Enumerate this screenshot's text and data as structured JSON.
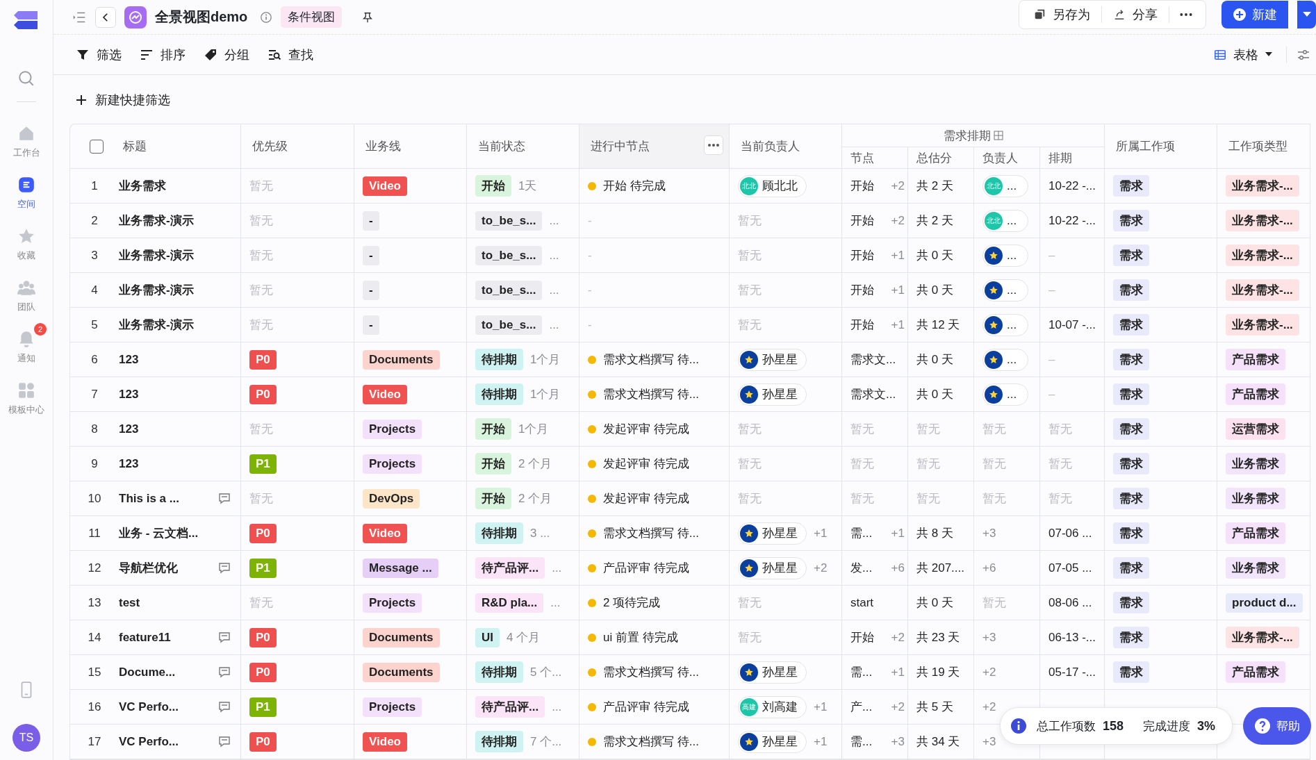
{
  "sidebar": {
    "avatar": "TS",
    "items": [
      {
        "label": "工作台",
        "selected": false
      },
      {
        "label": "空间",
        "selected": true
      },
      {
        "label": "收藏",
        "selected": false
      },
      {
        "label": "团队",
        "selected": false
      },
      {
        "label": "通知",
        "selected": false,
        "badge": "2"
      },
      {
        "label": "模板中心",
        "selected": false
      }
    ]
  },
  "topbar": {
    "title": "全景视图demo",
    "view_tag": "条件视图",
    "actions": [
      "另存为",
      "分享"
    ],
    "new_button": "新建"
  },
  "toolbar": {
    "tools": [
      "筛选",
      "排序",
      "分组",
      "查找"
    ],
    "view_switch": "表格"
  },
  "quick_filter": "新建快捷筛选",
  "table": {
    "select_all_checked": false,
    "columns": [
      {
        "label": "标题",
        "hovered": false
      },
      {
        "label": "优先级",
        "hovered": false
      },
      {
        "label": "业务线",
        "hovered": false
      },
      {
        "label": "当前状态",
        "hovered": false
      },
      {
        "label": "进行中节点",
        "hovered": true
      },
      {
        "label": "当前负责人",
        "hovered": false
      }
    ],
    "group": {
      "label": "需求排期",
      "columns": [
        "节点",
        "总估分",
        "负责人",
        "排期"
      ]
    },
    "columns_after": [
      "所属工作项",
      "工作项类型"
    ],
    "rows": [
      {
        "index": "1",
        "title": "业务需求",
        "comment": false,
        "priority": {
          "text": "暂无",
          "muted": true
        },
        "line": {
          "text": "Video",
          "color": "#f05252",
          "solid": true
        },
        "status": {
          "text": "开始",
          "color": "#d9f4dd",
          "duration": "1天"
        },
        "node": {
          "text": "开始 待完成",
          "dot": true
        },
        "owner": {
          "name": "顾北北",
          "avatar": {
            "kind": "initials",
            "text": "北北"
          }
        },
        "sched_node": {
          "text": "开始",
          "more": "+2"
        },
        "estimate": {
          "text": "共 2 天"
        },
        "sched_owner": {
          "avatar": {
            "kind": "initials",
            "text": "北北"
          },
          "text": "..."
        },
        "schedule": {
          "text": "10-22 -..."
        },
        "work_item": "需求",
        "type": {
          "text": "业务需求-...",
          "color": "#fde3e3"
        }
      },
      {
        "index": "2",
        "title": "业务需求-演示",
        "comment": false,
        "priority": {
          "text": "暂无",
          "muted": true
        },
        "line": {
          "text": "-",
          "color": "#ebebf0",
          "solid": false
        },
        "status": {
          "text": "to_be_s...",
          "color": "#ebebf0",
          "duration": "..."
        },
        "node": {
          "text": "-",
          "dot": false
        },
        "owner": {
          "text": "暂无",
          "muted": true
        },
        "sched_node": {
          "text": "开始",
          "more": "+2"
        },
        "estimate": {
          "text": "共 2 天"
        },
        "sched_owner": {
          "avatar": {
            "kind": "initials",
            "text": "北北"
          },
          "text": "..."
        },
        "schedule": {
          "text": "10-22 -..."
        },
        "work_item": "需求",
        "type": {
          "text": "业务需求-...",
          "color": "#fde3e3"
        }
      },
      {
        "index": "3",
        "title": "业务需求-演示",
        "comment": false,
        "priority": {
          "text": "暂无",
          "muted": true
        },
        "line": {
          "text": "-",
          "color": "#ebebf0",
          "solid": false
        },
        "status": {
          "text": "to_be_s...",
          "color": "#ebebf0",
          "duration": "..."
        },
        "node": {
          "text": "-",
          "dot": false
        },
        "owner": {
          "text": "暂无",
          "muted": true
        },
        "sched_node": {
          "text": "开始",
          "more": "+1"
        },
        "estimate": {
          "text": "共 0 天"
        },
        "sched_owner": {
          "avatar": {
            "kind": "star"
          },
          "text": "..."
        },
        "schedule": {
          "text": "–",
          "muted": true
        },
        "work_item": "需求",
        "type": {
          "text": "业务需求-...",
          "color": "#fde3e3"
        }
      },
      {
        "index": "4",
        "title": "业务需求-演示",
        "comment": false,
        "priority": {
          "text": "暂无",
          "muted": true
        },
        "line": {
          "text": "-",
          "color": "#ebebf0",
          "solid": false
        },
        "status": {
          "text": "to_be_s...",
          "color": "#ebebf0",
          "duration": "..."
        },
        "node": {
          "text": "-",
          "dot": false
        },
        "owner": {
          "text": "暂无",
          "muted": true
        },
        "sched_node": {
          "text": "开始",
          "more": "+1"
        },
        "estimate": {
          "text": "共 0 天"
        },
        "sched_owner": {
          "avatar": {
            "kind": "star"
          },
          "text": "..."
        },
        "schedule": {
          "text": "–",
          "muted": true
        },
        "work_item": "需求",
        "type": {
          "text": "业务需求-...",
          "color": "#fde3e3"
        }
      },
      {
        "index": "5",
        "title": "业务需求-演示",
        "comment": false,
        "priority": {
          "text": "暂无",
          "muted": true
        },
        "line": {
          "text": "-",
          "color": "#ebebf0",
          "solid": false
        },
        "status": {
          "text": "to_be_s...",
          "color": "#ebebf0",
          "duration": "..."
        },
        "node": {
          "text": "-",
          "dot": false
        },
        "owner": {
          "text": "暂无",
          "muted": true
        },
        "sched_node": {
          "text": "开始",
          "more": "+1"
        },
        "estimate": {
          "text": "共 12 天"
        },
        "sched_owner": {
          "avatar": {
            "kind": "star"
          },
          "text": "..."
        },
        "schedule": {
          "text": "10-07 -..."
        },
        "work_item": "需求",
        "type": {
          "text": "业务需求-...",
          "color": "#fde3e3"
        }
      },
      {
        "index": "6",
        "title": "123",
        "comment": false,
        "priority": {
          "text": "P0",
          "color": "#f04f4f"
        },
        "line": {
          "text": "Documents",
          "color": "#fcd3cd",
          "solid": false
        },
        "status": {
          "text": "待排期",
          "color": "#cff3f2",
          "duration": "1个月"
        },
        "node": {
          "text": "需求文档撰写 待...",
          "dot": true
        },
        "owner": {
          "name": "孙星星",
          "avatar": {
            "kind": "star"
          }
        },
        "sched_node": {
          "text": "需求文..."
        },
        "estimate": {
          "text": "共 0 天"
        },
        "sched_owner": {
          "avatar": {
            "kind": "star"
          },
          "text": "..."
        },
        "schedule": {
          "text": "–",
          "muted": true
        },
        "work_item": "需求",
        "type": {
          "text": "产品需求",
          "color": "#f6e1fb"
        }
      },
      {
        "index": "7",
        "title": "123",
        "comment": false,
        "priority": {
          "text": "P0",
          "color": "#f04f4f"
        },
        "line": {
          "text": "Video",
          "color": "#f05252",
          "solid": true
        },
        "status": {
          "text": "待排期",
          "color": "#cff3f2",
          "duration": "1个月"
        },
        "node": {
          "text": "需求文档撰写 待...",
          "dot": true
        },
        "owner": {
          "name": "孙星星",
          "avatar": {
            "kind": "star"
          }
        },
        "sched_node": {
          "text": "需求文..."
        },
        "estimate": {
          "text": "共 0 天"
        },
        "sched_owner": {
          "avatar": {
            "kind": "star"
          },
          "text": "..."
        },
        "schedule": {
          "text": "–",
          "muted": true
        },
        "work_item": "需求",
        "type": {
          "text": "产品需求",
          "color": "#f6e1fb"
        }
      },
      {
        "index": "8",
        "title": "123",
        "comment": false,
        "priority": {
          "text": "暂无",
          "muted": true
        },
        "line": {
          "text": "Projects",
          "color": "#f3e1fb",
          "solid": false
        },
        "status": {
          "text": "开始",
          "color": "#d9f4dd",
          "duration": "1个月"
        },
        "node": {
          "text": "发起评审 待完成",
          "dot": true
        },
        "owner": {
          "text": "暂无",
          "muted": true
        },
        "sched_node": {
          "text": "暂无",
          "muted": true
        },
        "estimate": {
          "text": "暂无",
          "muted": true
        },
        "sched_owner": {
          "text": "暂无",
          "muted": true
        },
        "schedule": {
          "text": "暂无",
          "muted": true
        },
        "work_item": "需求",
        "type": {
          "text": "运营需求",
          "color": "#fde1ee"
        }
      },
      {
        "index": "9",
        "title": "123",
        "comment": false,
        "priority": {
          "text": "P1",
          "color": "#7cb305"
        },
        "line": {
          "text": "Projects",
          "color": "#f3e1fb",
          "solid": false
        },
        "status": {
          "text": "开始",
          "color": "#d9f4dd",
          "duration": "2 个月"
        },
        "node": {
          "text": "发起评审 待完成",
          "dot": true
        },
        "owner": {
          "text": "暂无",
          "muted": true
        },
        "sched_node": {
          "text": "暂无",
          "muted": true
        },
        "estimate": {
          "text": "暂无",
          "muted": true
        },
        "sched_owner": {
          "text": "暂无",
          "muted": true
        },
        "schedule": {
          "text": "暂无",
          "muted": true
        },
        "work_item": "需求",
        "type": {
          "text": "业务需求",
          "color": "#f1e4fb"
        }
      },
      {
        "index": "10",
        "title": "This is a ...",
        "comment": true,
        "priority": {
          "text": "暂无",
          "muted": true
        },
        "line": {
          "text": "DevOps",
          "color": "#fde6c8",
          "solid": false
        },
        "status": {
          "text": "开始",
          "color": "#d9f4dd",
          "duration": "2 个月"
        },
        "node": {
          "text": "发起评审 待完成",
          "dot": true
        },
        "owner": {
          "text": "暂无",
          "muted": true
        },
        "sched_node": {
          "text": "暂无",
          "muted": true
        },
        "estimate": {
          "text": "暂无",
          "muted": true
        },
        "sched_owner": {
          "text": "暂无",
          "muted": true
        },
        "schedule": {
          "text": "暂无",
          "muted": true
        },
        "work_item": "需求",
        "type": {
          "text": "业务需求",
          "color": "#f1e4fb"
        }
      },
      {
        "index": "11",
        "title": "业务 - 云文档...",
        "comment": false,
        "priority": {
          "text": "P0",
          "color": "#f04f4f"
        },
        "line": {
          "text": "Video",
          "color": "#f05252",
          "solid": true
        },
        "status": {
          "text": "待排期",
          "color": "#cff3f2",
          "duration": "3 ..."
        },
        "node": {
          "text": "需求文档撰写 待...",
          "dot": true
        },
        "owner": {
          "name": "孙星星",
          "avatar": {
            "kind": "star"
          },
          "more": "+1"
        },
        "sched_node": {
          "text": "需...",
          "more": "+1"
        },
        "estimate": {
          "text": "共 8 天"
        },
        "sched_owner": {
          "text": "+3"
        },
        "schedule": {
          "text": "07-06 ..."
        },
        "work_item": "需求",
        "type": {
          "text": "产品需求",
          "color": "#f6e1fb"
        }
      },
      {
        "index": "12",
        "title": "导航栏优化",
        "comment": true,
        "priority": {
          "text": "P1",
          "color": "#7cb305"
        },
        "line": {
          "text": "Message ...",
          "color": "#e6cff7",
          "solid": false
        },
        "status": {
          "text": "待产品评...",
          "color": "#fbe3f8",
          "duration": "..."
        },
        "node": {
          "text": "产品评审 待完成",
          "dot": true
        },
        "owner": {
          "name": "孙星星",
          "avatar": {
            "kind": "star"
          },
          "more": "+2"
        },
        "sched_node": {
          "text": "发...",
          "more": "+6"
        },
        "estimate": {
          "text": "共 207...."
        },
        "sched_owner": {
          "text": "+6"
        },
        "schedule": {
          "text": "07-05 ..."
        },
        "work_item": "需求",
        "type": {
          "text": "业务需求",
          "color": "#f1e4fb"
        }
      },
      {
        "index": "13",
        "title": "test",
        "comment": false,
        "priority": {
          "text": "暂无",
          "muted": true
        },
        "line": {
          "text": "Projects",
          "color": "#f3e1fb",
          "solid": false
        },
        "status": {
          "text": "R&D pla...",
          "color": "#fbe3f8",
          "duration": "..."
        },
        "node": {
          "text": "2 项待完成",
          "dot": true
        },
        "owner": {
          "text": "暂无",
          "muted": true
        },
        "sched_node": {
          "text": "start"
        },
        "estimate": {
          "text": "共 0 天"
        },
        "sched_owner": {
          "text": "暂无",
          "muted": true
        },
        "schedule": {
          "text": "08-06 ..."
        },
        "work_item": "需求",
        "type": {
          "text": "product d...",
          "color": "#e6eafb"
        }
      },
      {
        "index": "14",
        "title": "feature11",
        "comment": true,
        "priority": {
          "text": "P0",
          "color": "#f04f4f"
        },
        "line": {
          "text": "Documents",
          "color": "#fcd3cd",
          "solid": false
        },
        "status": {
          "text": "UI",
          "color": "#cff3f2",
          "duration": "4 个月"
        },
        "node": {
          "text": "ui 前置 待完成",
          "dot": true
        },
        "owner": {
          "text": "暂无",
          "muted": true
        },
        "sched_node": {
          "text": "开始",
          "more": "+2"
        },
        "estimate": {
          "text": "共 23 天"
        },
        "sched_owner": {
          "text": "+3"
        },
        "schedule": {
          "text": "06-13 -..."
        },
        "work_item": "需求",
        "type": {
          "text": "业务需求-...",
          "color": "#fde3e3"
        }
      },
      {
        "index": "15",
        "title": "Docume...",
        "comment": true,
        "priority": {
          "text": "P0",
          "color": "#f04f4f"
        },
        "line": {
          "text": "Documents",
          "color": "#fcd3cd",
          "solid": false
        },
        "status": {
          "text": "待排期",
          "color": "#cff3f2",
          "duration": "5 个..."
        },
        "node": {
          "text": "需求文档撰写 待...",
          "dot": true
        },
        "owner": {
          "name": "孙星星",
          "avatar": {
            "kind": "star"
          }
        },
        "sched_node": {
          "text": "需...",
          "more": "+1"
        },
        "estimate": {
          "text": "共 19 天"
        },
        "sched_owner": {
          "text": "+2"
        },
        "schedule": {
          "text": "05-17 -..."
        },
        "work_item": "需求",
        "type": {
          "text": "产品需求",
          "color": "#f6e1fb"
        }
      },
      {
        "index": "16",
        "title": "VC Perfo...",
        "comment": true,
        "priority": {
          "text": "P1",
          "color": "#7cb305"
        },
        "line": {
          "text": "Projects",
          "color": "#f3e1fb",
          "solid": false
        },
        "status": {
          "text": "待产品评...",
          "color": "#fbe3f8",
          "duration": "..."
        },
        "node": {
          "text": "产品评审 待完成",
          "dot": true
        },
        "owner": {
          "name": "刘高建",
          "avatar": {
            "kind": "initials",
            "text": "高建"
          },
          "more": "+1"
        },
        "sched_node": {
          "text": "产...",
          "more": "+2"
        },
        "estimate": {
          "text": "共 5 天"
        },
        "sched_owner": {
          "text": "+2"
        }
      },
      {
        "index": "17",
        "title": "VC Perfo...",
        "comment": true,
        "priority": {
          "text": "P0",
          "color": "#f04f4f"
        },
        "line": {
          "text": "Video",
          "color": "#f05252",
          "solid": true
        },
        "status": {
          "text": "待排期",
          "color": "#cff3f2",
          "duration": "7 个..."
        },
        "node": {
          "text": "需求文档撰写 待...",
          "dot": true
        },
        "owner": {
          "name": "孙星星",
          "avatar": {
            "kind": "star"
          },
          "more": "+1"
        },
        "sched_node": {
          "text": "需...",
          "more": "+3"
        },
        "estimate": {
          "text": "共 34 天"
        },
        "sched_owner": {
          "text": "+3"
        }
      }
    ]
  },
  "summary": {
    "total_label": "总工作项数",
    "total": "158",
    "progress_label": "完成进度",
    "progress": "3%"
  },
  "help_button": "帮助"
}
